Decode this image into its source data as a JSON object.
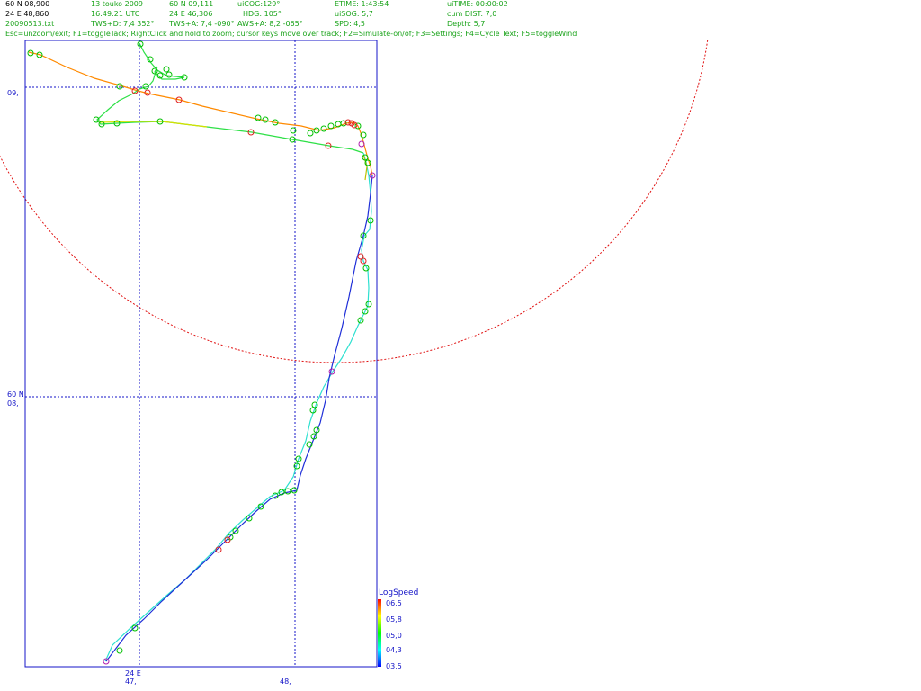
{
  "status": {
    "row1": {
      "cursor_lat": "60 N 08,900",
      "date": "13 touko 2009",
      "pos_lat": "60 N 09,111",
      "cog": "uiCOG:129°",
      "etime": "ETIME: 1:43:54",
      "uitime": "uiTIME: 00:00:02"
    },
    "row2": {
      "cursor_lon": "24 E 48,860",
      "time": "16:49:21  UTC",
      "pos_lon": "24 E 46,306",
      "hdg": "HDG: 105°",
      "sog": "uiSOG: 5,7",
      "cum_dist": "cum DIST: 7,0"
    },
    "row3": {
      "file": "20090513.txt",
      "tws_d": "TWS+D: 7,4 352°",
      "tws_a": "TWS+A: 7,4 -090°",
      "aws_a": "AWS+A: 8,2 -065°",
      "spd": "SPD: 4,5",
      "depth": "Depth: 5,7"
    },
    "help": "Esc=unzoom/exit; F1=toggleTack; RightClick and hold to zoom; cursor keys move over track; F2=Simulate-on/of; F3=Settings; F4=Cycle Text; F5=toggleWind"
  },
  "axes": {
    "lat_top": "09,",
    "lat_bottom_prefix": "60 N",
    "lat_bottom": "08,",
    "lon_left_prefix": "24 E",
    "lon_left": "47,",
    "lon_right": "48,"
  },
  "legend": {
    "title": "LogSpeed",
    "ticks": [
      "06,5",
      "05,8",
      "05,0",
      "04,3",
      "03,5"
    ],
    "values": [
      6.5,
      5.8,
      5.0,
      4.3,
      3.5
    ],
    "colors": [
      "#ff0000",
      "#ffff00",
      "#00ff00",
      "#00ffff",
      "#0000ff"
    ]
  },
  "colors": {
    "frame": "#1414c8",
    "grid": "#1414c8",
    "range_circle": "#e01010",
    "waypoint": "#00c000",
    "text_green": "#1aa31a"
  }
}
